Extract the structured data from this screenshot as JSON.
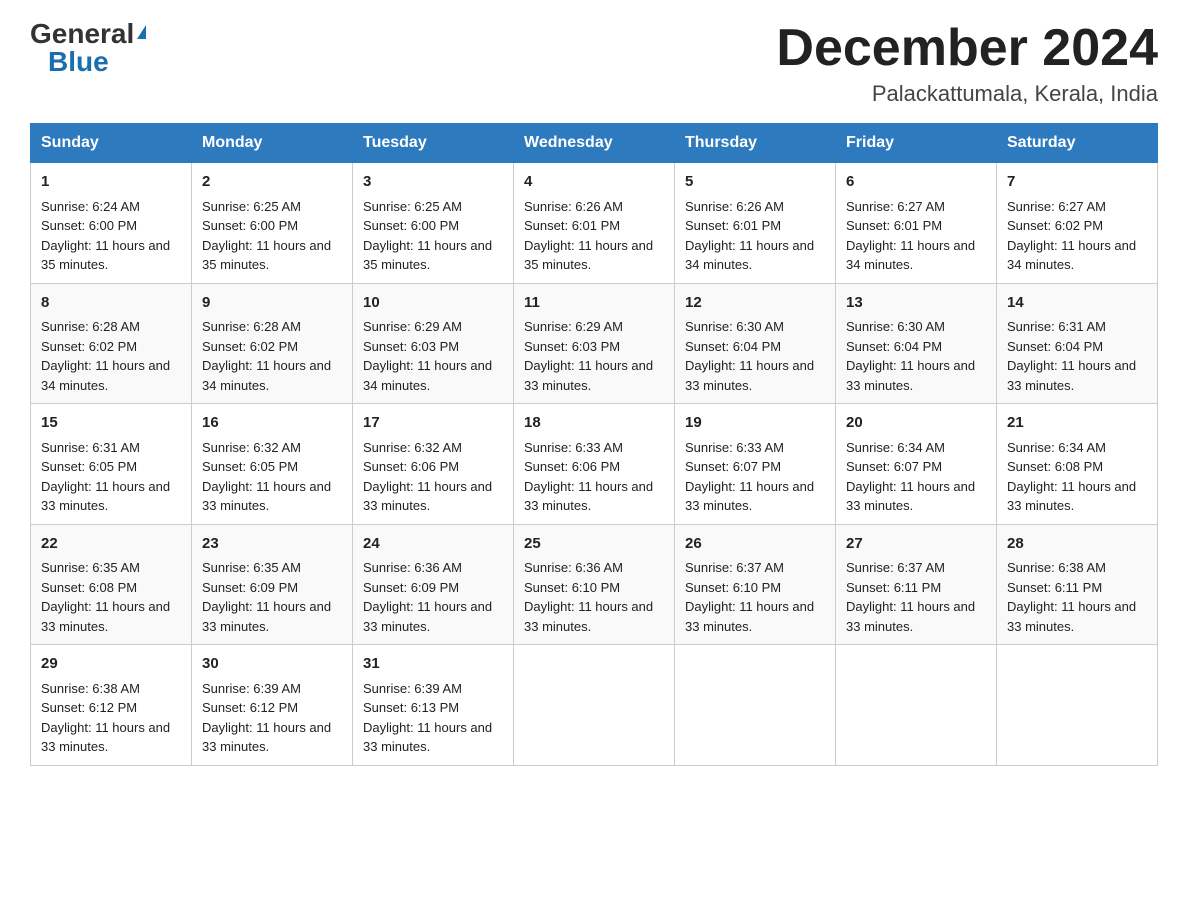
{
  "logo": {
    "general": "General",
    "blue": "Blue",
    "triangle": "▲"
  },
  "title": "December 2024",
  "location": "Palackattumala, Kerala, India",
  "days": [
    "Sunday",
    "Monday",
    "Tuesday",
    "Wednesday",
    "Thursday",
    "Friday",
    "Saturday"
  ],
  "weeks": [
    [
      {
        "day": "1",
        "sunrise": "6:24 AM",
        "sunset": "6:00 PM",
        "daylight": "11 hours and 35 minutes."
      },
      {
        "day": "2",
        "sunrise": "6:25 AM",
        "sunset": "6:00 PM",
        "daylight": "11 hours and 35 minutes."
      },
      {
        "day": "3",
        "sunrise": "6:25 AM",
        "sunset": "6:00 PM",
        "daylight": "11 hours and 35 minutes."
      },
      {
        "day": "4",
        "sunrise": "6:26 AM",
        "sunset": "6:01 PM",
        "daylight": "11 hours and 35 minutes."
      },
      {
        "day": "5",
        "sunrise": "6:26 AM",
        "sunset": "6:01 PM",
        "daylight": "11 hours and 34 minutes."
      },
      {
        "day": "6",
        "sunrise": "6:27 AM",
        "sunset": "6:01 PM",
        "daylight": "11 hours and 34 minutes."
      },
      {
        "day": "7",
        "sunrise": "6:27 AM",
        "sunset": "6:02 PM",
        "daylight": "11 hours and 34 minutes."
      }
    ],
    [
      {
        "day": "8",
        "sunrise": "6:28 AM",
        "sunset": "6:02 PM",
        "daylight": "11 hours and 34 minutes."
      },
      {
        "day": "9",
        "sunrise": "6:28 AM",
        "sunset": "6:02 PM",
        "daylight": "11 hours and 34 minutes."
      },
      {
        "day": "10",
        "sunrise": "6:29 AM",
        "sunset": "6:03 PM",
        "daylight": "11 hours and 34 minutes."
      },
      {
        "day": "11",
        "sunrise": "6:29 AM",
        "sunset": "6:03 PM",
        "daylight": "11 hours and 33 minutes."
      },
      {
        "day": "12",
        "sunrise": "6:30 AM",
        "sunset": "6:04 PM",
        "daylight": "11 hours and 33 minutes."
      },
      {
        "day": "13",
        "sunrise": "6:30 AM",
        "sunset": "6:04 PM",
        "daylight": "11 hours and 33 minutes."
      },
      {
        "day": "14",
        "sunrise": "6:31 AM",
        "sunset": "6:04 PM",
        "daylight": "11 hours and 33 minutes."
      }
    ],
    [
      {
        "day": "15",
        "sunrise": "6:31 AM",
        "sunset": "6:05 PM",
        "daylight": "11 hours and 33 minutes."
      },
      {
        "day": "16",
        "sunrise": "6:32 AM",
        "sunset": "6:05 PM",
        "daylight": "11 hours and 33 minutes."
      },
      {
        "day": "17",
        "sunrise": "6:32 AM",
        "sunset": "6:06 PM",
        "daylight": "11 hours and 33 minutes."
      },
      {
        "day": "18",
        "sunrise": "6:33 AM",
        "sunset": "6:06 PM",
        "daylight": "11 hours and 33 minutes."
      },
      {
        "day": "19",
        "sunrise": "6:33 AM",
        "sunset": "6:07 PM",
        "daylight": "11 hours and 33 minutes."
      },
      {
        "day": "20",
        "sunrise": "6:34 AM",
        "sunset": "6:07 PM",
        "daylight": "11 hours and 33 minutes."
      },
      {
        "day": "21",
        "sunrise": "6:34 AM",
        "sunset": "6:08 PM",
        "daylight": "11 hours and 33 minutes."
      }
    ],
    [
      {
        "day": "22",
        "sunrise": "6:35 AM",
        "sunset": "6:08 PM",
        "daylight": "11 hours and 33 minutes."
      },
      {
        "day": "23",
        "sunrise": "6:35 AM",
        "sunset": "6:09 PM",
        "daylight": "11 hours and 33 minutes."
      },
      {
        "day": "24",
        "sunrise": "6:36 AM",
        "sunset": "6:09 PM",
        "daylight": "11 hours and 33 minutes."
      },
      {
        "day": "25",
        "sunrise": "6:36 AM",
        "sunset": "6:10 PM",
        "daylight": "11 hours and 33 minutes."
      },
      {
        "day": "26",
        "sunrise": "6:37 AM",
        "sunset": "6:10 PM",
        "daylight": "11 hours and 33 minutes."
      },
      {
        "day": "27",
        "sunrise": "6:37 AM",
        "sunset": "6:11 PM",
        "daylight": "11 hours and 33 minutes."
      },
      {
        "day": "28",
        "sunrise": "6:38 AM",
        "sunset": "6:11 PM",
        "daylight": "11 hours and 33 minutes."
      }
    ],
    [
      {
        "day": "29",
        "sunrise": "6:38 AM",
        "sunset": "6:12 PM",
        "daylight": "11 hours and 33 minutes."
      },
      {
        "day": "30",
        "sunrise": "6:39 AM",
        "sunset": "6:12 PM",
        "daylight": "11 hours and 33 minutes."
      },
      {
        "day": "31",
        "sunrise": "6:39 AM",
        "sunset": "6:13 PM",
        "daylight": "11 hours and 33 minutes."
      },
      null,
      null,
      null,
      null
    ]
  ]
}
